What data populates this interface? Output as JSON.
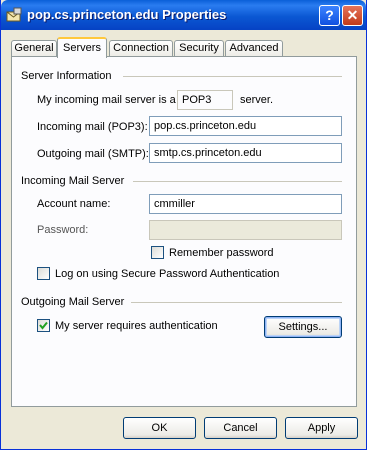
{
  "window": {
    "title": "pop.cs.princeton.edu Properties",
    "icon": "mail-server-icon"
  },
  "title_buttons": {
    "help": "?",
    "close": "✕"
  },
  "tabs": [
    {
      "label": "General",
      "active": false
    },
    {
      "label": "Servers",
      "active": true
    },
    {
      "label": "Connection",
      "active": false
    },
    {
      "label": "Security",
      "active": false
    },
    {
      "label": "Advanced",
      "active": false
    }
  ],
  "server_info": {
    "heading": "Server Information",
    "incoming_type_prefix": "My incoming mail server is a",
    "incoming_type_value": "POP3",
    "incoming_type_suffix": "server.",
    "incoming_label": "Incoming mail (POP3):",
    "incoming_value": "pop.cs.princeton.edu",
    "outgoing_label": "Outgoing mail (SMTP):",
    "outgoing_value": "smtp.cs.princeton.edu"
  },
  "incoming_server": {
    "heading": "Incoming Mail Server",
    "account_label": "Account name:",
    "account_value": "cmmiller",
    "password_label": "Password:",
    "password_value": "",
    "remember_label": "Remember password",
    "remember_checked": false,
    "spa_label": "Log on using Secure Password Authentication",
    "spa_checked": false
  },
  "outgoing_server": {
    "heading": "Outgoing Mail Server",
    "auth_label": "My server requires authentication",
    "auth_checked": true,
    "settings_button": "Settings..."
  },
  "footer": {
    "ok": "OK",
    "cancel": "Cancel",
    "apply": "Apply"
  }
}
